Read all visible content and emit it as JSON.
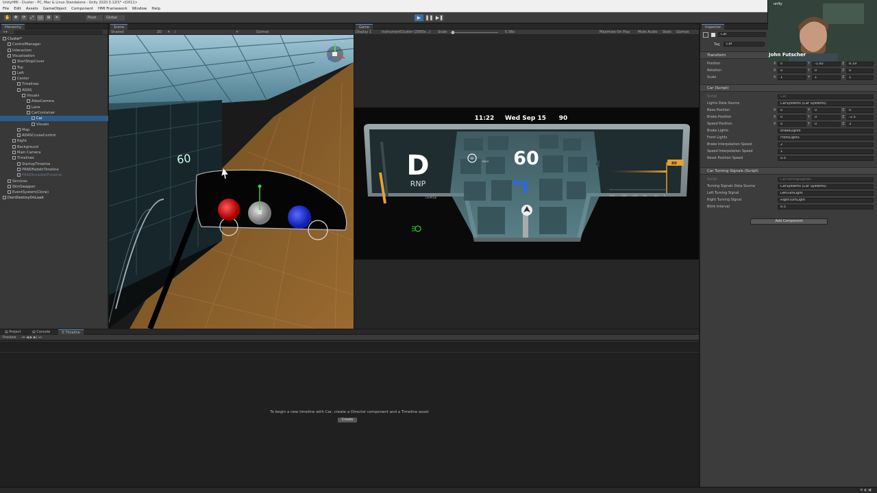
{
  "window": {
    "title": "UnityHMI - Cluster - PC, Mac & Linux Standalone - Unity 2020.3.12f1* <DX11>"
  },
  "menu": [
    "File",
    "Edit",
    "Assets",
    "GameObject",
    "Component",
    "HMI Framework",
    "Window",
    "Help"
  ],
  "toolbar": {
    "pivot": "Pivot",
    "global": "Global"
  },
  "hierarchy": {
    "tab": "Hierarchy",
    "items": [
      {
        "label": "Cluster*",
        "indent": 0,
        "kind": "root"
      },
      {
        "label": "ControlManager",
        "indent": 1
      },
      {
        "label": "Interaction",
        "indent": 1
      },
      {
        "label": "Visualization",
        "indent": 1
      },
      {
        "label": "StartStopCover",
        "indent": 2
      },
      {
        "label": "Top",
        "indent": 2
      },
      {
        "label": "Left",
        "indent": 2
      },
      {
        "label": "Center",
        "indent": 2
      },
      {
        "label": "Timelines",
        "indent": 3
      },
      {
        "label": "ADAS",
        "indent": 3
      },
      {
        "label": "Visuals",
        "indent": 4
      },
      {
        "label": "AdasCamera",
        "indent": 5
      },
      {
        "label": "Lane",
        "indent": 5
      },
      {
        "label": "CarContainer",
        "indent": 5
      },
      {
        "label": "Car",
        "indent": 6,
        "kind": "sel"
      },
      {
        "label": "Visuals",
        "indent": 6
      },
      {
        "label": "Map",
        "indent": 3
      },
      {
        "label": "ADASCruiseControl",
        "indent": 3
      },
      {
        "label": "Right",
        "indent": 2
      },
      {
        "label": "Background",
        "indent": 2
      },
      {
        "label": "Main Camera",
        "indent": 2
      },
      {
        "label": "Timelines",
        "indent": 2
      },
      {
        "label": "StartupTimeline",
        "indent": 3
      },
      {
        "label": "PRNDFadeInTimeline",
        "indent": 3
      },
      {
        "label": "PRNDInvisibleTimeline",
        "indent": 3,
        "kind": "dim"
      },
      {
        "label": "Services",
        "indent": 1
      },
      {
        "label": "SkinSwapper",
        "indent": 1
      },
      {
        "label": "EventSystem(Clone)",
        "indent": 1
      },
      {
        "label": "DontDestroyOnLoad",
        "indent": 0,
        "kind": "root"
      }
    ]
  },
  "scene": {
    "tab": "Scene",
    "shading": "Shaded",
    "mode_2d": "2D",
    "gizmos": "Gizmos",
    "sign_text": "60"
  },
  "game": {
    "tab": "Game",
    "display": "Display 1",
    "resolution": "InstrumentCluster (2560x...)",
    "scale_label": "Scale",
    "scale_value": "0.38x",
    "maximize": "Maximize On Play",
    "mute": "Mute Audio",
    "stats": "Stats",
    "gizmos": "Gizmos"
  },
  "cluster": {
    "time": "11:22",
    "date": "Wed Sep 15",
    "temp": "90",
    "gear": "D",
    "gear_options": "RNP",
    "speed": "60",
    "speed_limit": "60",
    "speed_limit_unit": "KM/H",
    "charge_label": "CHARGE",
    "power_badge": "80",
    "power_ticks": [
      "-200",
      "-160",
      "-120",
      "-80",
      "-40",
      "0"
    ]
  },
  "inspector": {
    "tab": "Inspector",
    "object_name": "Car",
    "tag_label": "Tag",
    "tag_value": "Car",
    "transform": {
      "title": "Transform",
      "rows": [
        {
          "label": "Position",
          "x": "0",
          "y": "-1.82",
          "z": "6.19"
        },
        {
          "label": "Rotation",
          "x": "0",
          "y": "0",
          "z": "0"
        },
        {
          "label": "Scale",
          "x": "1",
          "y": "1",
          "z": "1"
        }
      ]
    },
    "car_script": {
      "title": "Car (Script)",
      "script_label": "Script",
      "script_value": "Car",
      "lights_label": "Lights Data Source",
      "lights_value": "CarSystems (Car Systems)",
      "base_label": "Base Position",
      "base": {
        "x": "0",
        "y": "0",
        "z": "0"
      },
      "brake_label": "Brake Position",
      "brake": {
        "x": "0",
        "y": "0",
        "z": "-2.5"
      },
      "speed_label": "Speed Position",
      "speed": {
        "x": "0",
        "y": "0",
        "z": "3"
      },
      "brake_lights_label": "Brake Lights",
      "brake_lights_value": "BrakeLights",
      "front_lights_label": "Front Lights",
      "front_lights_value": "FrontLights",
      "brake_interp_label": "Brake Interpolation Speed",
      "brake_interp_value": "2",
      "speed_interp_label": "Speed Interpolation Speed",
      "speed_interp_value": "1",
      "reset_label": "Reset Position Speed",
      "reset_value": "0.5"
    },
    "turning": {
      "title": "Car Turning Signals (Script)",
      "script_label": "Script",
      "script_value": "CarTurningSignals",
      "source_label": "Turning Signals Data Source",
      "source_value": "CarSystems (Car Systems)",
      "left_label": "Left Turning Signal",
      "left_value": "LeftTurnLight",
      "right_label": "Right Turning Signal",
      "right_value": "RightTurnLight",
      "blink_label": "Blink Interval",
      "blink_value": "0.5"
    },
    "add_component": "Add Component"
  },
  "timeline": {
    "tabs": [
      "Project",
      "Console",
      "Timeline"
    ],
    "preview_label": "Preview",
    "message": "To begin a new timeline with Car, create a Director component and a Timeline asset",
    "create_button": "Create"
  },
  "webcam": {
    "name": "John Futscher",
    "badge": "unity"
  },
  "colors": {
    "accent": "#2c5d87",
    "cluster_amber": "#e8a030",
    "map_teal": "#5f8d96"
  }
}
